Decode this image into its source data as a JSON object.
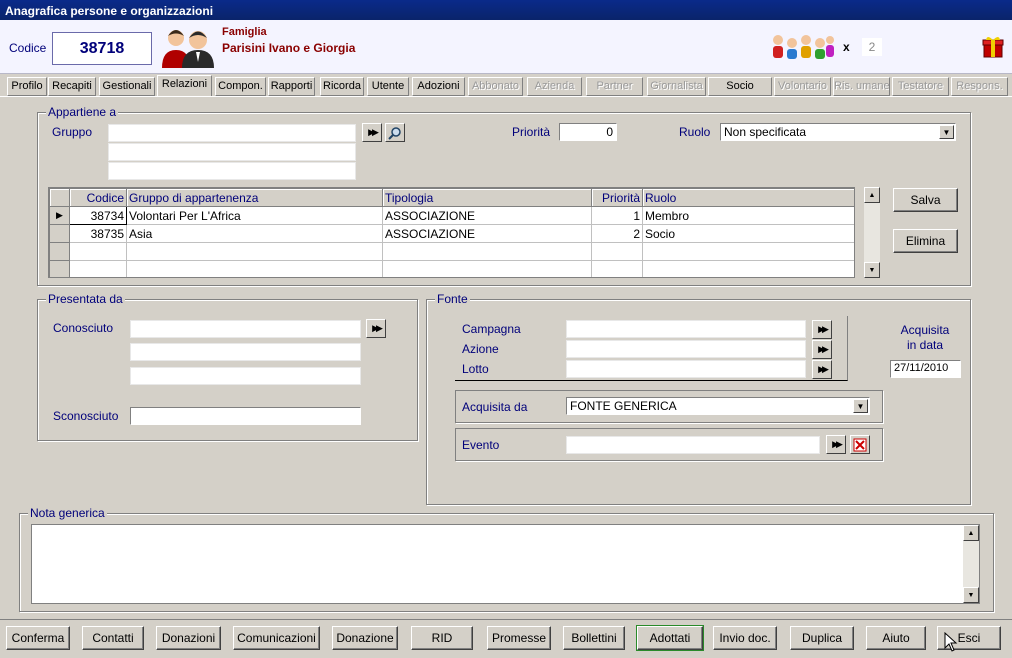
{
  "window": {
    "title": "Anagrafica persone e organizzazioni"
  },
  "header": {
    "codice_label": "Codice",
    "codice_value": "38718",
    "type_label": "Famiglia",
    "name": "Parisini Ivano e Giorgia",
    "members_x": "x",
    "members_count": "2"
  },
  "tabs": [
    {
      "label": "Profilo",
      "state": "normal"
    },
    {
      "label": "Recapiti",
      "state": "normal"
    },
    {
      "label": "Gestionali",
      "state": "normal"
    },
    {
      "label": "Relazioni",
      "state": "active"
    },
    {
      "label": "Compon.",
      "state": "normal"
    },
    {
      "label": "Rapporti",
      "state": "normal"
    },
    {
      "label": "Ricorda",
      "state": "normal"
    },
    {
      "label": "Utente",
      "state": "normal"
    },
    {
      "label": "Adozioni",
      "state": "normal"
    },
    {
      "label": "Abbonato",
      "state": "disabled"
    },
    {
      "label": "Azienda",
      "state": "disabled"
    },
    {
      "label": "Partner",
      "state": "disabled"
    },
    {
      "label": "Giornalista",
      "state": "disabled"
    },
    {
      "label": "Socio",
      "state": "normal"
    },
    {
      "label": "Volontario",
      "state": "disabled"
    },
    {
      "label": "Ris. umane",
      "state": "disabled"
    },
    {
      "label": "Testatore",
      "state": "disabled"
    },
    {
      "label": "Respons.",
      "state": "disabled"
    }
  ],
  "appartiene": {
    "legend": "Appartiene a",
    "gruppo_label": "Gruppo",
    "gruppo_value": "",
    "priorita_label": "Priorità",
    "priorita_value": "0",
    "ruolo_label": "Ruolo",
    "ruolo_value": "Non specificata",
    "columns": [
      "Codice",
      "Gruppo di appartenenza",
      "Tipologia",
      "Priorità",
      "Ruolo"
    ],
    "rows": [
      {
        "codice": "38734",
        "gruppo": "Volontari Per L'Africa",
        "tipologia": "ASSOCIAZIONE",
        "priorita": "1",
        "ruolo": "Membro"
      },
      {
        "codice": "38735",
        "gruppo": "Asia",
        "tipologia": "ASSOCIAZIONE",
        "priorita": "2",
        "ruolo": "Socio"
      }
    ],
    "salva": "Salva",
    "elimina": "Elimina"
  },
  "presentata": {
    "legend": "Presentata da",
    "conosciuto_label": "Conosciuto",
    "sconosciuto_label": "Sconosciuto"
  },
  "fonte": {
    "legend": "Fonte",
    "campagna_label": "Campagna",
    "azione_label": "Azione",
    "lotto_label": "Lotto",
    "acquisita_in_data_label_1": "Acquisita",
    "acquisita_in_data_label_2": "in data",
    "acquisita_in_data_value": "27/11/2010",
    "acquisita_da_label": "Acquisita da",
    "acquisita_da_value": "FONTE GENERICA",
    "evento_label": "Evento"
  },
  "nota": {
    "legend": "Nota generica",
    "value": ""
  },
  "bottom_buttons": [
    "Conferma",
    "Contatti",
    "Donazioni",
    "Comunicazioni",
    "Donazione",
    "RID",
    "Promesse",
    "Bollettini",
    "Adottati",
    "Invio doc.",
    "Duplica",
    "Aiuto",
    "Esci"
  ],
  "colors": {
    "title_bar": "#0a246a",
    "label_blue": "#00007a",
    "name_red": "#8a0000",
    "face": "#d4d0c8"
  }
}
